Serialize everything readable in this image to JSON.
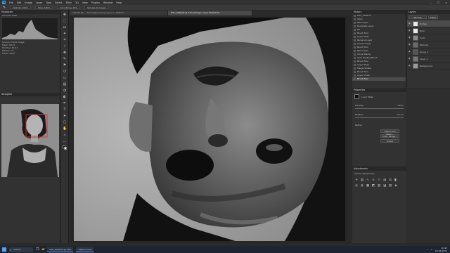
{
  "menubar": {
    "logo": "Ps",
    "items": [
      "File",
      "Edit",
      "Image",
      "Layer",
      "Type",
      "Select",
      "Filter",
      "3D",
      "View",
      "Plugins",
      "Window",
      "Help"
    ]
  },
  "options": {
    "items": [
      "Opacity: 100%",
      "Flow: 100%",
      "Smoothing: 10%",
      "Sample All Layers"
    ]
  },
  "tabs": [
    {
      "label": "20150116_...-Hand-Retouching (Layer 1, RGB/8*)",
      "active": false
    },
    {
      "label": "DSC_9566.tif @ 33% (Dodge, Layer Mask/16*)",
      "active": true
    }
  ],
  "left": {
    "histogram_title": "Histogram",
    "channel_label": "Channel: RGB",
    "source_label": "Source: Entire Image",
    "stat_rows": [
      "Mean: 84.21",
      "Std Dev: 62.47",
      "Median: 71",
      "Pixels: 8192"
    ],
    "navigator_title": "Navigator"
  },
  "history": {
    "title": "History",
    "items": [
      "DSC_9566.tif",
      "Open",
      "New Layer",
      "Duplicate Layer",
      "Fill",
      "Brush Tool",
      "Layer Mask",
      "Rename Layer",
      "Curves Layer",
      "Brush Tool",
      "New Layer",
      "Clone Stamp",
      "Spot Healing Brush",
      "Brush Tool",
      "Layer Style",
      "Merge Visible",
      "Brush Tool",
      "Layer Order",
      "Brush Tool"
    ],
    "selected_index": 18
  },
  "layers": {
    "title": "Layers",
    "blend": "Normal",
    "opacity": "100%",
    "items": [
      {
        "name": "Dodge",
        "selected": true
      },
      {
        "name": "Burn",
        "selected": false
      },
      {
        "name": "Color",
        "selected": false
      },
      {
        "name": "Retouch",
        "selected": false
      },
      {
        "name": "Group 1",
        "selected": false
      },
      {
        "name": "Layer 1",
        "selected": false
      },
      {
        "name": "Background",
        "selected": false
      }
    ]
  },
  "properties": {
    "title": "Properties",
    "type": "Layer Mask",
    "density_label": "Density:",
    "density_value": "100%",
    "feather_label": "Feather:",
    "feather_value": "0.0 px",
    "refine_label": "Refine:",
    "btn_select": "Select and Mask...",
    "btn_color": "Color Range...",
    "btn_invert": "Invert"
  },
  "adjustments": {
    "title": "Adjustments",
    "subtitle": "Add an adjustment",
    "icons": [
      "brightness-icon",
      "levels-icon",
      "curves-icon",
      "exposure-icon",
      "vibrance-icon",
      "hue-icon",
      "colorbalance-icon",
      "bw-icon",
      "photofilter-icon",
      "channelmixer-icon",
      "colorlookup-icon",
      "invert-icon",
      "posterize-icon",
      "threshold-icon",
      "gradientmap-icon",
      "selectivecolor-icon"
    ]
  },
  "taskbar": {
    "search_placeholder": "Search",
    "apps": [
      "DSC_9566.tif @ 33%",
      "Capture One"
    ],
    "time": "10:42",
    "date": "03.06.2021"
  }
}
